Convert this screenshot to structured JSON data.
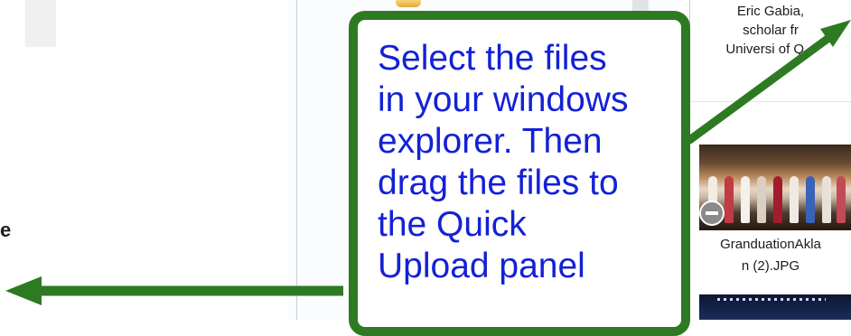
{
  "left_pane": {
    "partial_text": "e"
  },
  "thumbnails": [
    {
      "caption_lines": [
        "Eric Gabia,",
        "scholar fr",
        "Universi  of Q..."
      ]
    },
    {
      "caption_lines": [
        "GranduationAkla",
        "n (2).JPG"
      ]
    }
  ],
  "callout": {
    "lines": [
      "Select the files",
      "in your windows",
      "explorer.  Then",
      "drag the files to",
      "the Quick",
      "Upload panel"
    ]
  },
  "colors": {
    "callout_border": "#2d7a22",
    "callout_text": "#1321d6",
    "arrow": "#2d7a22"
  }
}
